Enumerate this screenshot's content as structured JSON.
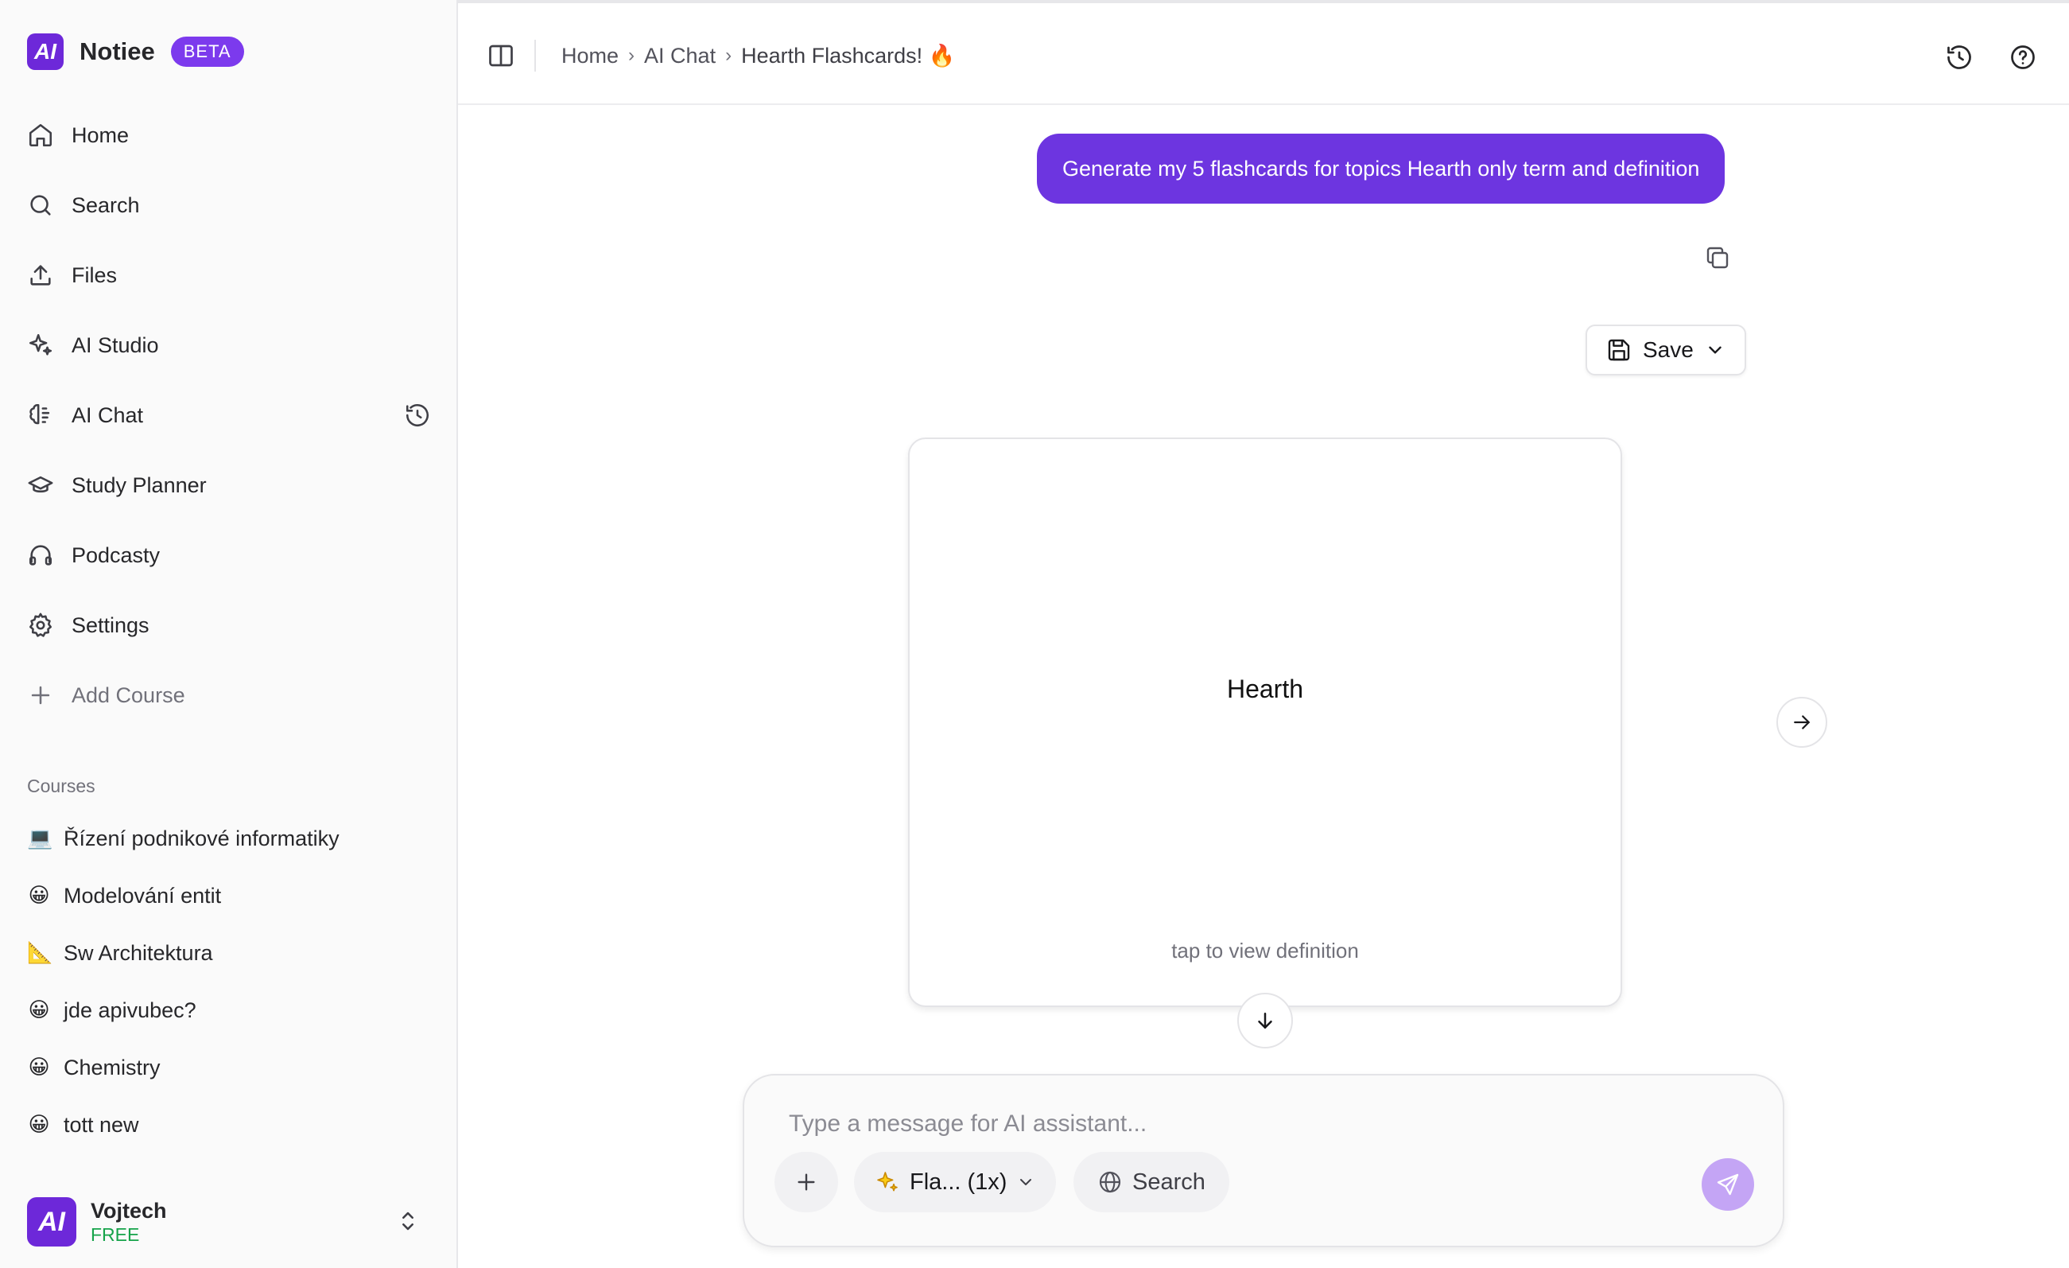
{
  "brand": {
    "name": "Notiee",
    "badge": "BETA",
    "logo_text": "AI"
  },
  "sidebar": {
    "nav": [
      {
        "label": "Home",
        "icon": "home-icon"
      },
      {
        "label": "Search",
        "icon": "search-icon"
      },
      {
        "label": "Files",
        "icon": "upload-icon"
      },
      {
        "label": "AI Studio",
        "icon": "sparkles-icon"
      },
      {
        "label": "AI Chat",
        "icon": "brain-icon",
        "trailing_icon": "history-icon"
      },
      {
        "label": "Study Planner",
        "icon": "graduation-cap-icon"
      },
      {
        "label": "Podcasty",
        "icon": "headphones-icon"
      },
      {
        "label": "Settings",
        "icon": "gear-icon"
      },
      {
        "label": "Add Course",
        "icon": "plus-icon"
      }
    ],
    "courses_label": "Courses",
    "courses": [
      {
        "emoji": "💻",
        "label": "Řízení podnikové informatiky"
      },
      {
        "emoji": "😀",
        "label": "Modelování entit"
      },
      {
        "emoji": "📐",
        "label": "Sw Architektura"
      },
      {
        "emoji": "😀",
        "label": "jde apivubec?"
      },
      {
        "emoji": "😀",
        "label": "Chemistry"
      },
      {
        "emoji": "😀",
        "label": "tott new"
      }
    ],
    "user": {
      "name": "Vojtech",
      "plan": "FREE",
      "avatar_text": "AI"
    }
  },
  "header": {
    "breadcrumbs": [
      "Home",
      "AI Chat",
      "Hearth Flashcards! 🔥"
    ],
    "icons": [
      "history-icon",
      "help-icon"
    ]
  },
  "chat": {
    "user_message": "Generate my 5 flashcards for topics Hearth only term and definition",
    "save_label": "Save",
    "flashcard": {
      "term": "Hearth",
      "hint": "tap to view definition"
    }
  },
  "composer": {
    "placeholder": "Type a message for AI assistant...",
    "mode_label": "Fla... (1x)",
    "search_label": "Search"
  },
  "colors": {
    "accent": "#6d35e0",
    "badge": "#7c3aed",
    "send_disabled": "#c4a5f5",
    "plan_green": "#16a34a"
  }
}
